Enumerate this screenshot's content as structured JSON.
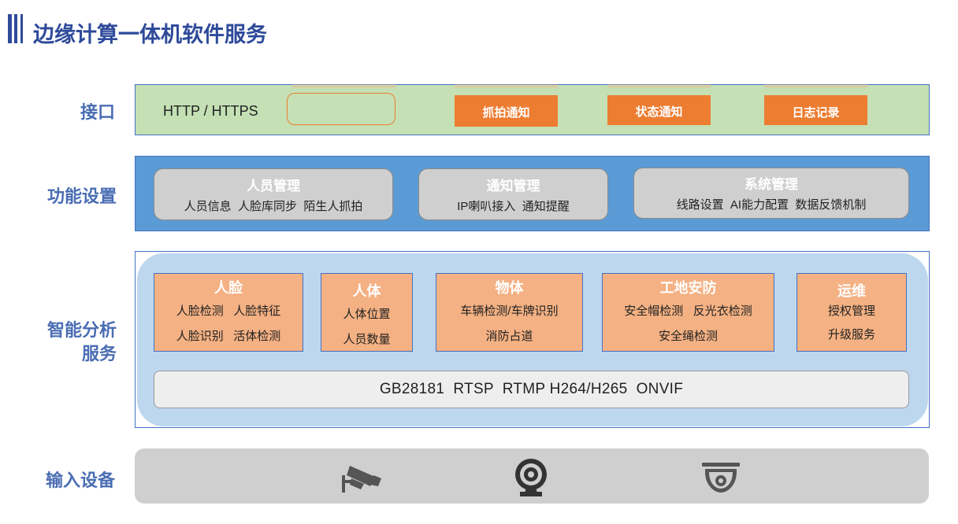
{
  "title": "边缘计算一体机软件服务",
  "rows": {
    "interface": "接口",
    "functions": "功能设置",
    "analysis_line1": "智能分析",
    "analysis_line2": "服务",
    "input": "输入设备"
  },
  "interface": {
    "protocol": "HTTP / HTTPS",
    "buttons": [
      "抓拍通知",
      "状态通知",
      "日志记录"
    ]
  },
  "functions": [
    {
      "title": "人员管理",
      "items": "人员信息  人脸库同步  陌生人抓拍"
    },
    {
      "title": "通知管理",
      "items": "IP喇叭接入  通知提醒"
    },
    {
      "title": "系统管理",
      "items": "线路设置  AI能力配置  数据反馈机制"
    }
  ],
  "analysis": [
    {
      "title": "人脸",
      "lines": [
        "人脸检测   人脸特征",
        "人脸识别   活体检测"
      ]
    },
    {
      "title": "人体",
      "lines": [
        "人体位置",
        "人员数量"
      ]
    },
    {
      "title": "物体",
      "lines": [
        "车辆检测/车牌识别",
        "消防占道"
      ]
    },
    {
      "title": "工地安防",
      "lines": [
        "安全帽检测   反光衣检测",
        "安全绳检测"
      ]
    },
    {
      "title": "运维",
      "lines": [
        "授权管理",
        "升级服务"
      ]
    }
  ],
  "protocols": "GB28181  RTSP  RTMP H264/H265  ONVIF",
  "devices": [
    "bullet-camera-icon",
    "webcam-icon",
    "dome-camera-icon"
  ],
  "colors": {
    "title": "#2e4a9a",
    "label": "#4a6db3",
    "interface_bg": "#c5e0b4",
    "function_bg": "#5b9bd5",
    "analysis_bg": "#bdd7ee",
    "accent_orange": "#ed7d31",
    "card_orange": "#f4b183",
    "input_bg": "#d0cfcf"
  }
}
